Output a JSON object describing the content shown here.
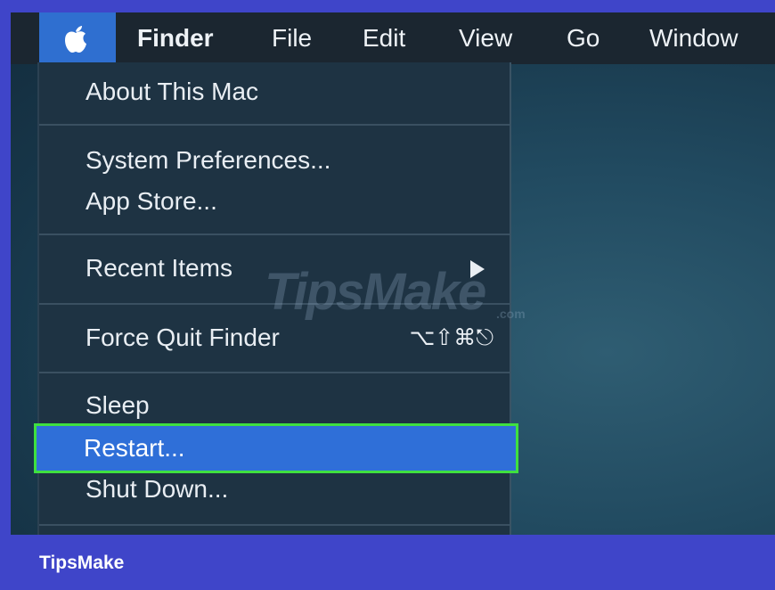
{
  "menubar": {
    "items": [
      "Finder",
      "File",
      "Edit",
      "View",
      "Go",
      "Window"
    ]
  },
  "apple_menu": {
    "about": "About This Mac",
    "system_preferences": "System Preferences...",
    "app_store": "App Store...",
    "recent_items": "Recent Items",
    "force_quit": "Force Quit Finder",
    "force_quit_shortcut": "⌥⇧⌘⎋",
    "sleep": "Sleep",
    "restart": "Restart...",
    "shut_down": "Shut Down..."
  },
  "watermark": {
    "text": "TipsMake",
    "suffix": ".com"
  },
  "footer": {
    "brand": "TipsMake"
  },
  "colors": {
    "highlight": "#2f6fd8",
    "highlight_border": "#3fe03f",
    "menubar": "#1b2630",
    "footer": "#3f45c9"
  }
}
